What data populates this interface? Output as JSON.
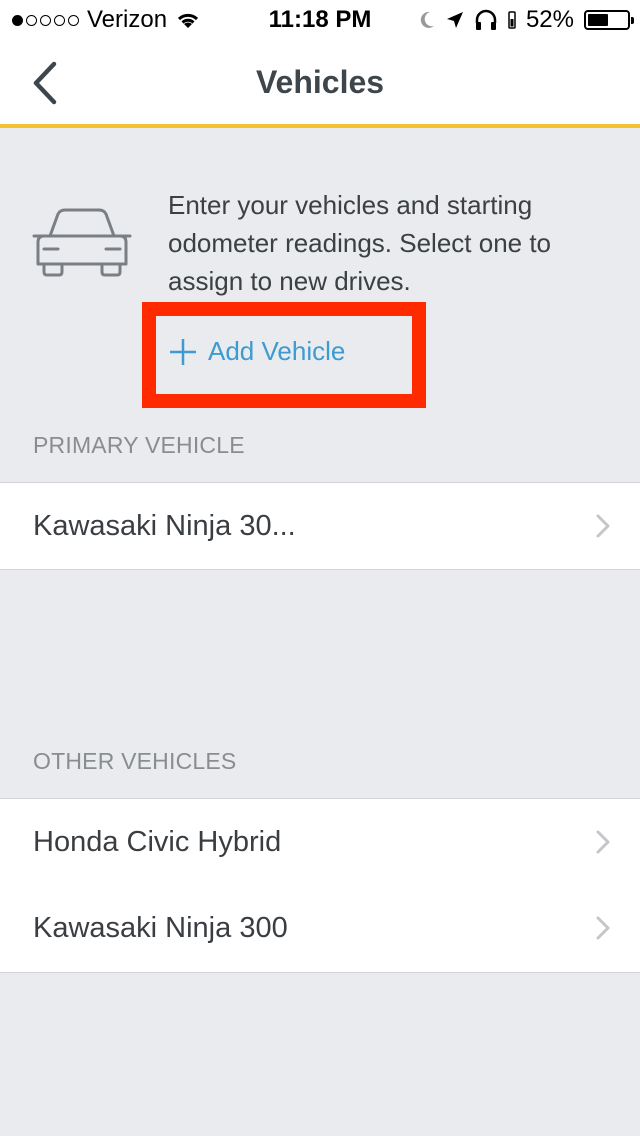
{
  "status_bar": {
    "carrier": "Verizon",
    "time": "11:18 PM",
    "battery": "52%",
    "battery_level": 0.52
  },
  "nav": {
    "title": "Vehicles",
    "back_icon": "chevron-left-icon"
  },
  "intro": {
    "text": "Enter your vehicles and starting odometer readings. Select one to assign to new drives.",
    "add_label": "Add Vehicle",
    "car_icon": "car-icon"
  },
  "primary": {
    "header": "PRIMARY VEHICLE",
    "items": [
      {
        "label": "Kawasaki Ninja 30..."
      }
    ]
  },
  "other": {
    "header": "OTHER VEHICLES",
    "items": [
      {
        "label": "Honda Civic Hybrid"
      },
      {
        "label": "Kawasaki Ninja 300"
      }
    ]
  },
  "colors": {
    "accent": "#3d9bd0",
    "nav_underline": "#f2c230",
    "highlight": "#ff2a00",
    "background": "#e9ebee"
  }
}
